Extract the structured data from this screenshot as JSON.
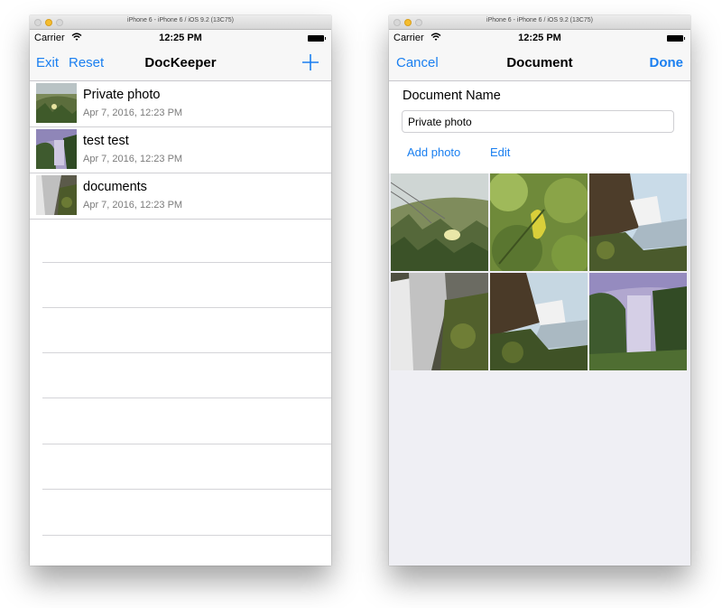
{
  "left_window": {
    "window_title": "iPhone 6 - iPhone 6 / iOS 9.2 (13C75)",
    "status": {
      "carrier": "Carrier",
      "time": "12:25 PM"
    },
    "nav": {
      "left_1": "Exit",
      "left_2": "Reset",
      "title": "DocKeeper",
      "add_icon": "plus-icon"
    },
    "documents": [
      {
        "title": "Private photo",
        "date": "Apr 7, 2016, 12:23 PM",
        "thumb": "grass-flower"
      },
      {
        "title": "test test",
        "date": "Apr 7, 2016, 12:23 PM",
        "thumb": "waterfall-purple"
      },
      {
        "title": "documents",
        "date": "Apr 7, 2016, 12:23 PM",
        "thumb": "cascade"
      }
    ]
  },
  "right_window": {
    "window_title": "iPhone 6 - iPhone 6 / iOS 9.2 (13C75)",
    "status": {
      "carrier": "Carrier",
      "time": "12:25 PM"
    },
    "nav": {
      "left": "Cancel",
      "title": "Document",
      "right": "Done"
    },
    "form": {
      "label": "Document Name",
      "name_value": "Private photo",
      "add_photo": "Add photo",
      "edit": "Edit"
    },
    "photos": [
      "grass-flower",
      "leaves",
      "waterfall-cliff",
      "cascade",
      "waterfall-cliff-2",
      "waterfall-purple"
    ]
  },
  "colors": {
    "accent": "#1a7ff0",
    "separator": "#cfcfd3",
    "background": "#efeff4"
  }
}
